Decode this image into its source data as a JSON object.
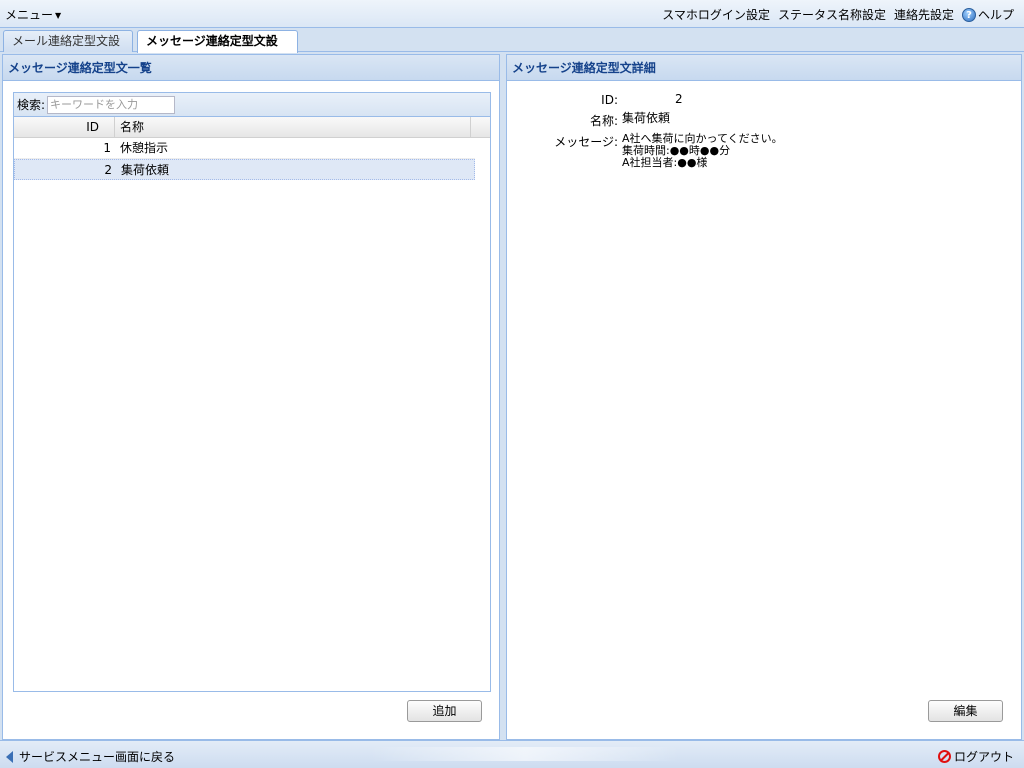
{
  "topbar": {
    "menu_label": "メニュー",
    "links": [
      "スマホログイン設定",
      "ステータス名称設定",
      "連絡先設定"
    ],
    "help_label": "ヘルプ"
  },
  "tabs": [
    {
      "label": "メール連絡定型文設定",
      "active": false
    },
    {
      "label": "メッセージ連絡定型文設定",
      "active": true
    }
  ],
  "list_panel": {
    "title": "メッセージ連絡定型文一覧",
    "search_label": "検索:",
    "search_placeholder": "キーワードを入力",
    "columns": [
      "ID",
      "名称"
    ],
    "rows": [
      {
        "id": "1",
        "name": "休憩指示",
        "selected": false
      },
      {
        "id": "2",
        "name": "集荷依頼",
        "selected": true
      }
    ],
    "add_button": "追加"
  },
  "detail_panel": {
    "title": "メッセージ連絡定型文詳細",
    "id_label": "ID:",
    "id_value": "2",
    "name_label": "名称:",
    "name_value": "集荷依頼",
    "message_label": "メッセージ:",
    "message_value": "A社へ集荷に向かってください。\n集荷時間:●●時●●分\nA社担当者:●●様",
    "edit_button": "編集"
  },
  "bottombar": {
    "back_label": "サービスメニュー画面に戻る",
    "logout_label": "ログアウト"
  },
  "colors": {
    "accent": "#15428b",
    "border": "#99bbe8",
    "selected_row": "#dfe8f6",
    "logout_icon": "#e01010"
  }
}
